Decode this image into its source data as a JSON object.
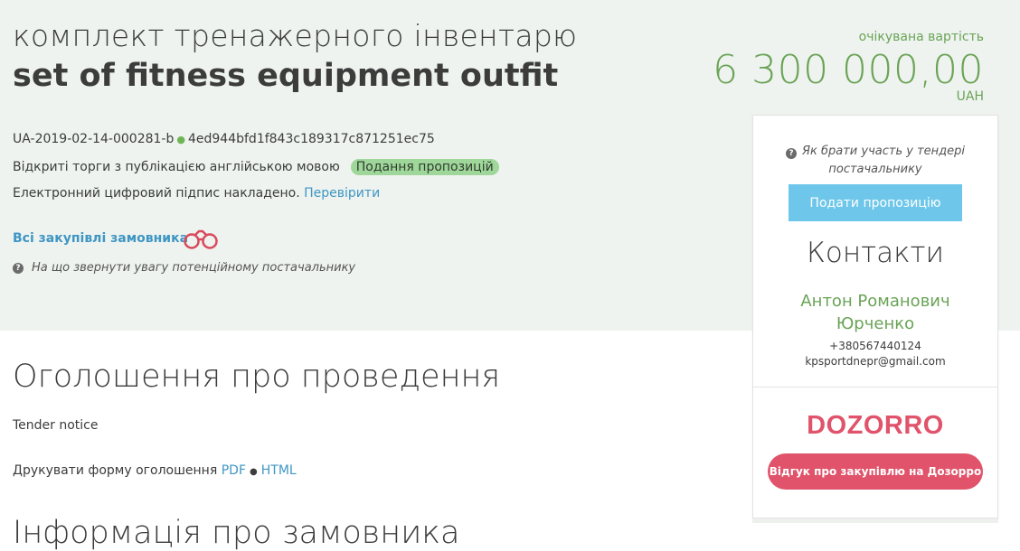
{
  "tender": {
    "title_ua": "комплект тренажерного інвентарю",
    "title_en": "set of fitness equipment outfit",
    "id": "UA-2019-02-14-000281-b",
    "hash": "4ed944bfd1f843c189317c871251ec75",
    "procedure": "Відкриті торги з публікацією англійською мовою",
    "status": "Подання пропозицій",
    "signature_text": "Електронний цифровий підпис накладено.",
    "verify_link": "Перевірити",
    "customer_link": "Всі закупівлі замовника",
    "attention_text": "На що звернути увагу потенційному постачальнику"
  },
  "price": {
    "label": "очікувана вартість",
    "value": "6 300 000,00",
    "currency": "UAH"
  },
  "sidebar": {
    "how_to": "Як брати участь у тендері постачальнику",
    "submit_button": "Подати пропозицію",
    "contacts_heading": "Контакти",
    "contact_name": "Антон Романович Юрченко",
    "phone": "+380567440124",
    "email": "kpsportdnepr@gmail.com",
    "dozorro_logo": "DOZORRO",
    "feedback_button": "Відгук про закупівлю на Дозорро"
  },
  "main": {
    "announce_heading": "Оголошення про проведення",
    "notice_sub": "Tender notice",
    "print_text": "Друкувати форму оголошення",
    "print_pdf": "PDF",
    "print_html": "HTML",
    "customer_heading": "Інформація про замовника"
  },
  "colors": {
    "band": "#eef3ef",
    "green": "#6aa356",
    "link": "#3f96c4",
    "submit": "#6ec7ea",
    "dozorro": "#e0536a"
  },
  "icons": [
    "question-circle-icon",
    "binoculars-icon",
    "status-dot-icon"
  ]
}
